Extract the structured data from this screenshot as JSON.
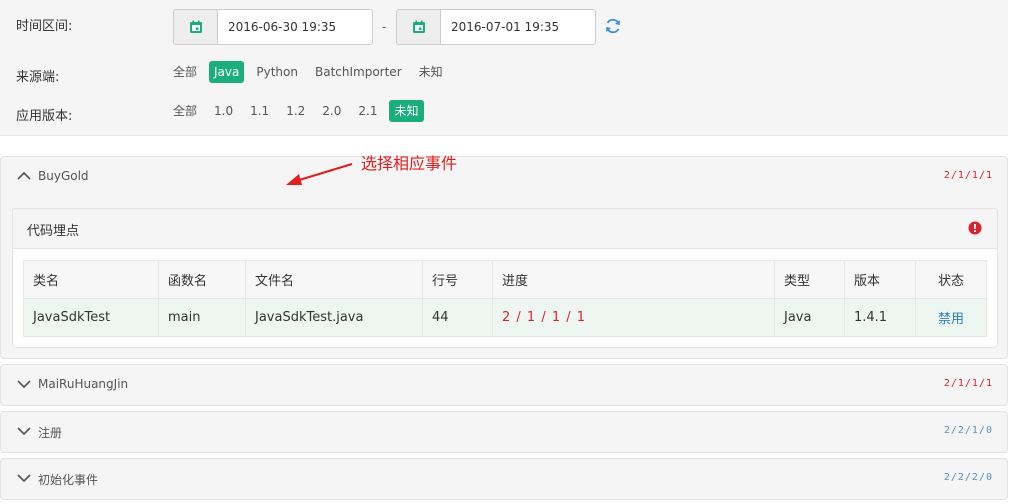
{
  "filters": {
    "time_label": "时间区间:",
    "start_date": "2016-06-30 19:35",
    "date_separator": "-",
    "end_date": "2016-07-01 19:35",
    "source_label": "来源端:",
    "source_options": [
      "全部",
      "Java",
      "Python",
      "BatchImporter",
      "未知"
    ],
    "source_selected": "Java",
    "version_label": "应用版本:",
    "version_options": [
      "全部",
      "1.0",
      "1.1",
      "1.2",
      "2.0",
      "2.1",
      "未知"
    ],
    "version_selected": "未知"
  },
  "annotation": {
    "text": "选择相应事件"
  },
  "events": [
    {
      "name": "BuyGold",
      "count": "2/1/1/1",
      "count_color": "red",
      "expanded": true,
      "section": {
        "title": "代码埋点",
        "columns": [
          "类名",
          "函数名",
          "文件名",
          "行号",
          "进度",
          "类型",
          "版本",
          "状态"
        ],
        "rows": [
          {
            "class_name": "JavaSdkTest",
            "function": "main",
            "file": "JavaSdkTest.java",
            "line": "44",
            "progress": "2 / 1 / 1 / 1",
            "type": "Java",
            "version": "1.4.1",
            "status": "禁用"
          }
        ]
      }
    },
    {
      "name": "MaiRuHuangJin",
      "count": "2/1/1/1",
      "count_color": "red",
      "expanded": false
    },
    {
      "name": "注册",
      "count": "2/2/1/0",
      "count_color": "blue",
      "expanded": false
    },
    {
      "name": "初始化事件",
      "count": "2/2/2/0",
      "count_color": "blue",
      "expanded": false
    }
  ],
  "colors": {
    "accent": "#1aae7c",
    "alert": "#d9232d",
    "link": "#2b7fc1",
    "count_blue": "#5a8fc7"
  }
}
